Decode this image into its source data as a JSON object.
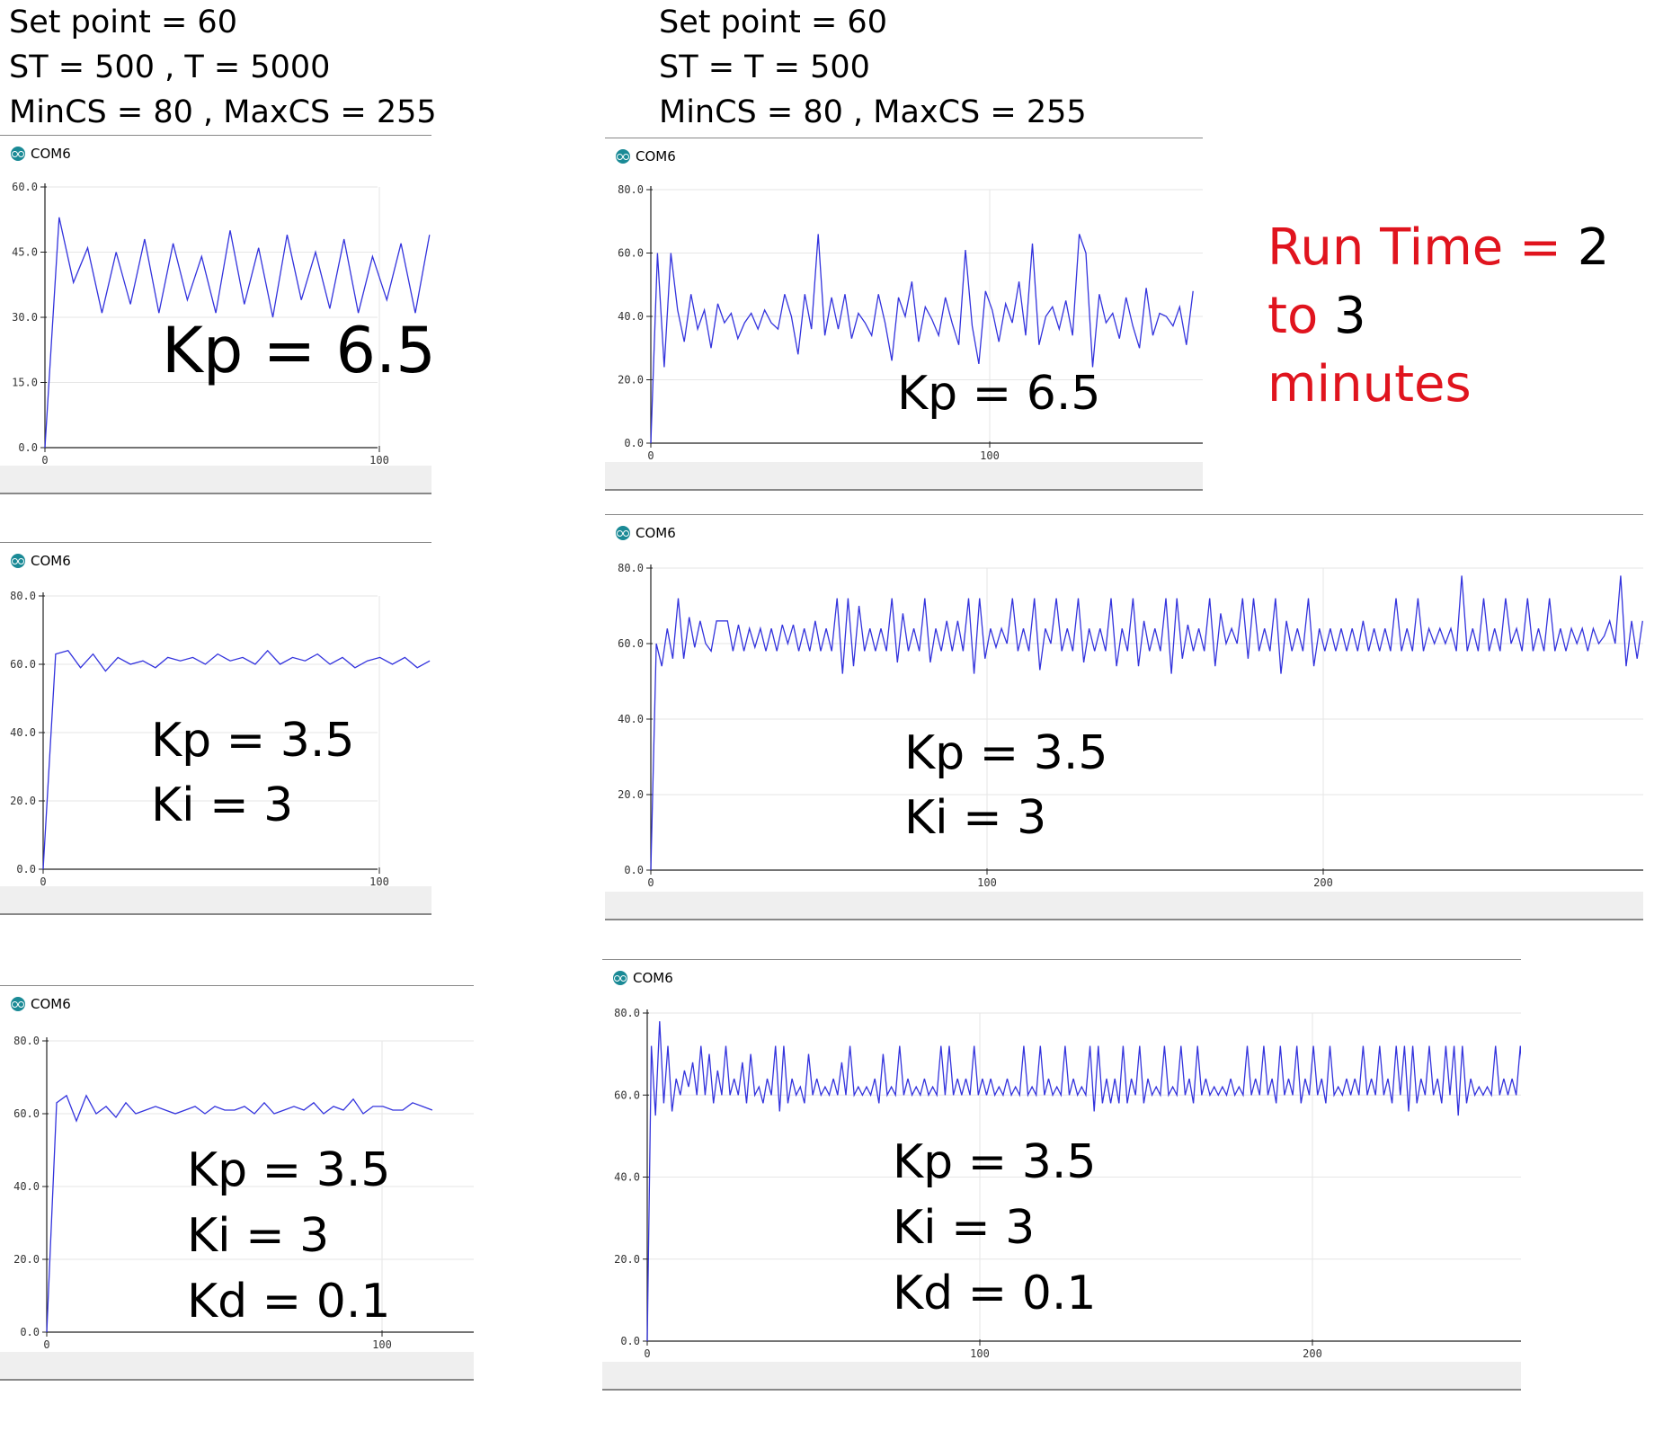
{
  "left_header": [
    "Set point = 60",
    "ST = 500 , T = 5000",
    "MinCS = 80 , MaxCS = 255"
  ],
  "right_header": [
    "Set point = 60",
    "ST = T = 500",
    "MinCS = 80 , MaxCS = 255"
  ],
  "run_time": {
    "prefix": "Run Time = ",
    "from": "2",
    "mid": " to ",
    "to": "3",
    "suffix": "minutes"
  },
  "colors": {
    "line": "#3333dd",
    "grid": "#e6e6e6",
    "axis": "#222222",
    "runtime_red": "#e0141e",
    "logo": "#1a8a96"
  },
  "window_title": "COM6",
  "chart_data": [
    {
      "type": "line",
      "panel": "left-1",
      "title": "COM6",
      "ylim": [
        0,
        60
      ],
      "xlim": [
        0,
        115
      ],
      "yticks": [
        "0.0",
        "15.0",
        "30.0",
        "45.0",
        "60.0"
      ],
      "xticks": [
        "0",
        "100"
      ],
      "gains": [
        "Kp = 6.5"
      ],
      "values": [
        0,
        53,
        38,
        46,
        31,
        45,
        33,
        48,
        31,
        47,
        34,
        44,
        31,
        50,
        33,
        46,
        30,
        49,
        34,
        45,
        32,
        48,
        31,
        44,
        34,
        47,
        31,
        49
      ]
    },
    {
      "type": "line",
      "panel": "right-1",
      "title": "COM6",
      "ylim": [
        0,
        80
      ],
      "xlim": [
        0,
        160
      ],
      "yticks": [
        "0.0",
        "20.0",
        "40.0",
        "60.0",
        "80.0"
      ],
      "xticks": [
        "0",
        "100"
      ],
      "gains": [
        "Kp = 6.5"
      ],
      "values": [
        0,
        60,
        24,
        60,
        42,
        32,
        47,
        36,
        42,
        30,
        44,
        38,
        41,
        33,
        38,
        41,
        36,
        42,
        38,
        36,
        47,
        40,
        28,
        47,
        36,
        66,
        34,
        46,
        36,
        47,
        33,
        41,
        38,
        34,
        47,
        38,
        26,
        46,
        40,
        51,
        32,
        43,
        39,
        34,
        46,
        38,
        31,
        61,
        37,
        25,
        48,
        42,
        32,
        44,
        38,
        51,
        34,
        63,
        31,
        40,
        43,
        36,
        45,
        34,
        66,
        60,
        24,
        47,
        38,
        41,
        33,
        46,
        37,
        30,
        49,
        34,
        41,
        40,
        37,
        43,
        31,
        48
      ]
    },
    {
      "type": "line",
      "panel": "left-2",
      "title": "COM6",
      "ylim": [
        0,
        80
      ],
      "xlim": [
        0,
        115
      ],
      "yticks": [
        "0.0",
        "20.0",
        "40.0",
        "60.0",
        "80.0"
      ],
      "xticks": [
        "0",
        "100"
      ],
      "gains": [
        "Kp = 3.5",
        "Ki = 3"
      ],
      "values": [
        0,
        63,
        64,
        59,
        63,
        58,
        62,
        60,
        61,
        59,
        62,
        61,
        62,
        60,
        63,
        61,
        62,
        60,
        64,
        60,
        62,
        61,
        63,
        60,
        62,
        59,
        61,
        62,
        60,
        62,
        59,
        61
      ]
    },
    {
      "type": "line",
      "panel": "right-2",
      "title": "COM6",
      "ylim": [
        0,
        80
      ],
      "xlim": [
        0,
        295
      ],
      "yticks": [
        "0.0",
        "20.0",
        "40.0",
        "60.0",
        "80.0"
      ],
      "xticks": [
        "0",
        "100",
        "200"
      ],
      "gains": [
        "Kp = 3.5",
        "Ki = 3"
      ],
      "values": [
        0,
        60,
        54,
        64,
        56,
        72,
        56,
        67,
        59,
        66,
        60,
        58,
        66,
        66,
        66,
        58,
        65,
        58,
        64,
        59,
        64,
        58,
        64,
        58,
        65,
        60,
        65,
        58,
        64,
        58,
        66,
        58,
        64,
        58,
        72,
        52,
        72,
        54,
        70,
        58,
        64,
        58,
        64,
        58,
        72,
        55,
        68,
        58,
        64,
        58,
        72,
        55,
        64,
        58,
        66,
        58,
        66,
        58,
        72,
        52,
        72,
        56,
        64,
        59,
        64,
        60,
        72,
        58,
        64,
        58,
        72,
        53,
        64,
        60,
        72,
        58,
        64,
        58,
        72,
        55,
        64,
        58,
        64,
        58,
        72,
        54,
        64,
        58,
        72,
        54,
        66,
        58,
        64,
        58,
        72,
        52,
        72,
        56,
        65,
        58,
        64,
        58,
        72,
        54,
        68,
        60,
        64,
        60,
        72,
        56,
        72,
        58,
        64,
        58,
        72,
        52,
        66,
        58,
        64,
        58,
        72,
        54,
        64,
        58,
        64,
        58,
        64,
        58,
        64,
        58,
        66,
        58,
        64,
        58,
        64,
        58,
        72,
        58,
        64,
        58,
        72,
        58,
        64,
        60,
        64,
        60,
        64,
        58,
        78,
        58,
        64,
        58,
        72,
        58,
        64,
        58,
        72,
        60,
        64,
        58,
        72,
        58,
        64,
        58,
        72,
        58,
        64,
        58,
        64,
        60,
        64,
        58,
        64,
        60,
        62,
        66,
        60,
        78,
        54,
        66,
        56,
        66
      ]
    },
    {
      "type": "line",
      "panel": "left-3",
      "title": "COM6",
      "ylim": [
        0,
        80
      ],
      "xlim": [
        0,
        115
      ],
      "yticks": [
        "0.0",
        "20.0",
        "40.0",
        "60.0",
        "80.0"
      ],
      "xticks": [
        "0",
        "100"
      ],
      "gains": [
        "Kp = 3.5",
        "Ki = 3",
        "Kd = 0.1"
      ],
      "values": [
        0,
        63,
        65,
        58,
        65,
        60,
        62,
        59,
        63,
        60,
        61,
        62,
        61,
        60,
        61,
        62,
        60,
        62,
        61,
        61,
        62,
        60,
        63,
        60,
        61,
        62,
        61,
        63,
        60,
        62,
        61,
        64,
        60,
        62,
        62,
        61,
        61,
        63,
        62,
        61
      ]
    },
    {
      "type": "line",
      "panel": "right-3",
      "title": "COM6",
      "ylim": [
        0,
        80
      ],
      "xlim": [
        0,
        265
      ],
      "yticks": [
        "0.0",
        "20.0",
        "40.0",
        "60.0",
        "80.0"
      ],
      "xticks": [
        "0",
        "100",
        "200"
      ],
      "gains": [
        "Kp = 3.5",
        "Ki = 3",
        "Kd = 0.1"
      ],
      "values": [
        0,
        72,
        55,
        78,
        58,
        72,
        56,
        64,
        60,
        66,
        62,
        68,
        60,
        72,
        60,
        70,
        58,
        66,
        60,
        72,
        60,
        64,
        60,
        68,
        58,
        70,
        60,
        62,
        58,
        64,
        60,
        72,
        56,
        72,
        58,
        64,
        60,
        62,
        58,
        70,
        60,
        64,
        60,
        62,
        60,
        64,
        60,
        68,
        60,
        72,
        60,
        62,
        60,
        62,
        60,
        64,
        58,
        70,
        60,
        62,
        60,
        72,
        60,
        64,
        60,
        62,
        60,
        64,
        60,
        62,
        60,
        72,
        60,
        72,
        60,
        64,
        60,
        64,
        60,
        72,
        60,
        64,
        60,
        64,
        60,
        62,
        60,
        64,
        60,
        62,
        60,
        72,
        60,
        62,
        60,
        72,
        60,
        64,
        60,
        62,
        60,
        72,
        60,
        64,
        60,
        62,
        60,
        72,
        56,
        72,
        58,
        64,
        58,
        64,
        58,
        72,
        58,
        64,
        60,
        72,
        58,
        64,
        60,
        62,
        60,
        72,
        60,
        62,
        60,
        72,
        60,
        64,
        58,
        72,
        60,
        64,
        60,
        62,
        60,
        62,
        60,
        64,
        60,
        62,
        60,
        72,
        60,
        64,
        60,
        72,
        60,
        64,
        58,
        72,
        60,
        64,
        60,
        72,
        58,
        64,
        60,
        72,
        60,
        64,
        58,
        72,
        60,
        62,
        60,
        64,
        60,
        64,
        60,
        72,
        60,
        64,
        60,
        72,
        60,
        64,
        58,
        72,
        60,
        72,
        56,
        72,
        58,
        64,
        60,
        72,
        60,
        64,
        58,
        72,
        60,
        72,
        55,
        72,
        58,
        64,
        60,
        62,
        60,
        62,
        60,
        72,
        60,
        64,
        60,
        64,
        60,
        72,
        60,
        64
      ]
    }
  ]
}
